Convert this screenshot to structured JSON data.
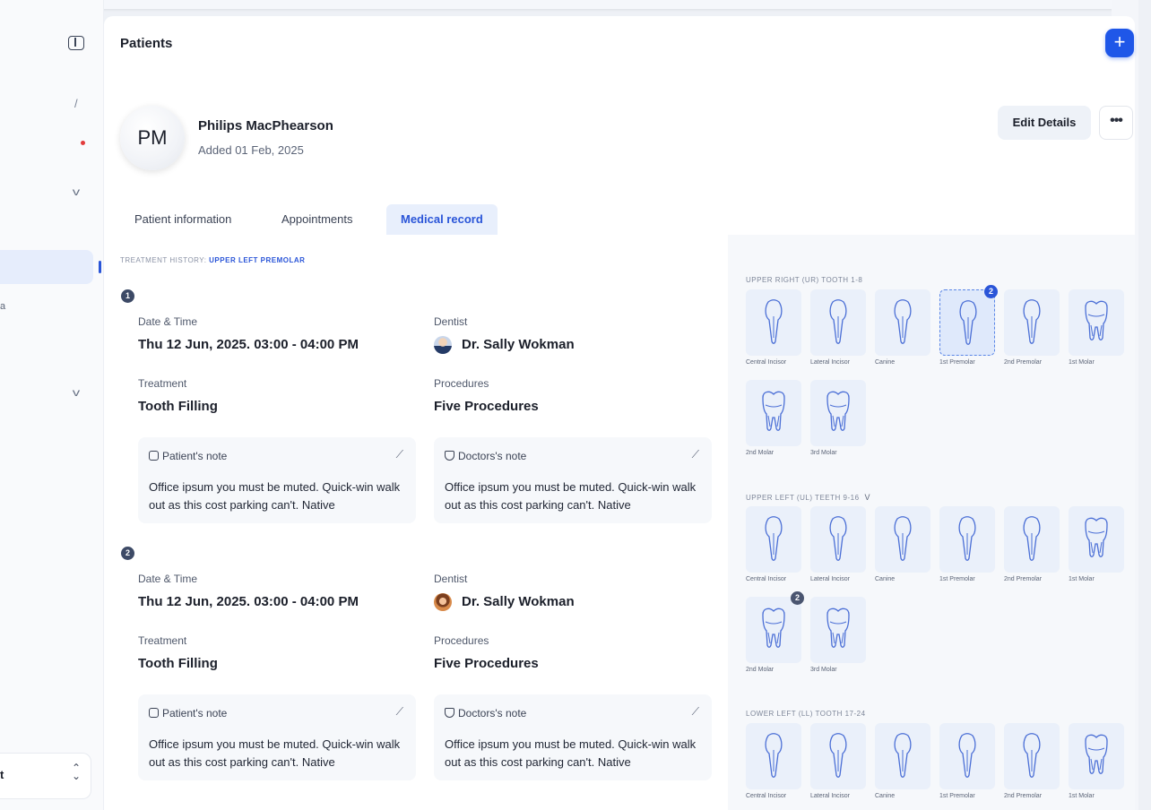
{
  "header": {
    "title": "Patients",
    "add_icon": "plus-icon"
  },
  "patient": {
    "initials": "PM",
    "name": "Philips MacPhearson",
    "added": "Added 01 Feb, 2025",
    "edit_label": "Edit Details",
    "more_label": "•••"
  },
  "tabs": [
    {
      "label": "Patient information",
      "active": false
    },
    {
      "label": "Appointments",
      "active": false
    },
    {
      "label": "Medical record",
      "active": true
    }
  ],
  "sidebar": {
    "slash": "/",
    "mini_label": "a",
    "select_label": "t",
    "select_arrows": "⌃⌄"
  },
  "history": {
    "label": "TREATMENT HISTORY",
    "link": "UPPER LEFT PREMOLAR"
  },
  "records": [
    {
      "step": "1",
      "date_label": "Date & Time",
      "date": "Thu 12 Jun, 2025. 03:00 - 04:00 PM",
      "dentist_label": "Dentist",
      "dentist": "Dr. Sally Wokman",
      "treatment_label": "Treatment",
      "treatment": "Tooth Filling",
      "procedure_label": "Procedures",
      "procedure": "Five Procedures",
      "patient_note_title": "Patient's note",
      "patient_note": "Office ipsum you must be muted. Quick-win walk out as this cost parking can't. Native",
      "doctor_note_title": "Doctors's note",
      "doctor_note": "Office ipsum you must be muted. Quick-win walk out as this cost parking can't. Native"
    },
    {
      "step": "2",
      "date_label": "Date & Time",
      "date": "Thu 12 Jun, 2025. 03:00 - 04:00 PM",
      "dentist_label": "Dentist",
      "dentist": "Dr. Sally Wokman",
      "treatment_label": "Treatment",
      "treatment": "Tooth Filling",
      "procedure_label": "Procedures",
      "procedure": "Five Procedures",
      "patient_note_title": "Patient's note",
      "patient_note": "Office ipsum you must be muted. Quick-win walk out as this cost parking can't. Native",
      "doctor_note_title": "Doctors's note",
      "doctor_note": "Office ipsum you must be muted. Quick-win walk out as this cost parking can't. Native"
    }
  ],
  "teeth_groups": [
    {
      "label": "UPPER RIGHT (UR) TOOTH 1-8",
      "teeth": [
        "Central Incisor",
        "Lateral Incisor",
        "Canine",
        "1st Premolar",
        "2nd Premolar",
        "1st Molar",
        "2nd Molar",
        "3rd Molar"
      ],
      "selected": 3,
      "badge": "2"
    },
    {
      "label": "UPPER LEFT (UL) TEETH 9-16",
      "teeth": [
        "Central Incisor",
        "Lateral Incisor",
        "Canine",
        "1st Premolar",
        "2nd Premolar",
        "1st Molar",
        "2nd Molar",
        "3rd Molar"
      ],
      "badge": "2"
    },
    {
      "label": "LOWER LEFT (LL) TOOTH 17-24",
      "teeth": [
        "Central Incisor",
        "Lateral Incisor",
        "Canine",
        "1st Premolar",
        "2nd Premolar",
        "1st Molar"
      ]
    }
  ],
  "colors": {
    "accent": "#1f57e8",
    "tooth_bg": "#eaf0fa",
    "tooth_stroke": "#4b6fd6"
  }
}
